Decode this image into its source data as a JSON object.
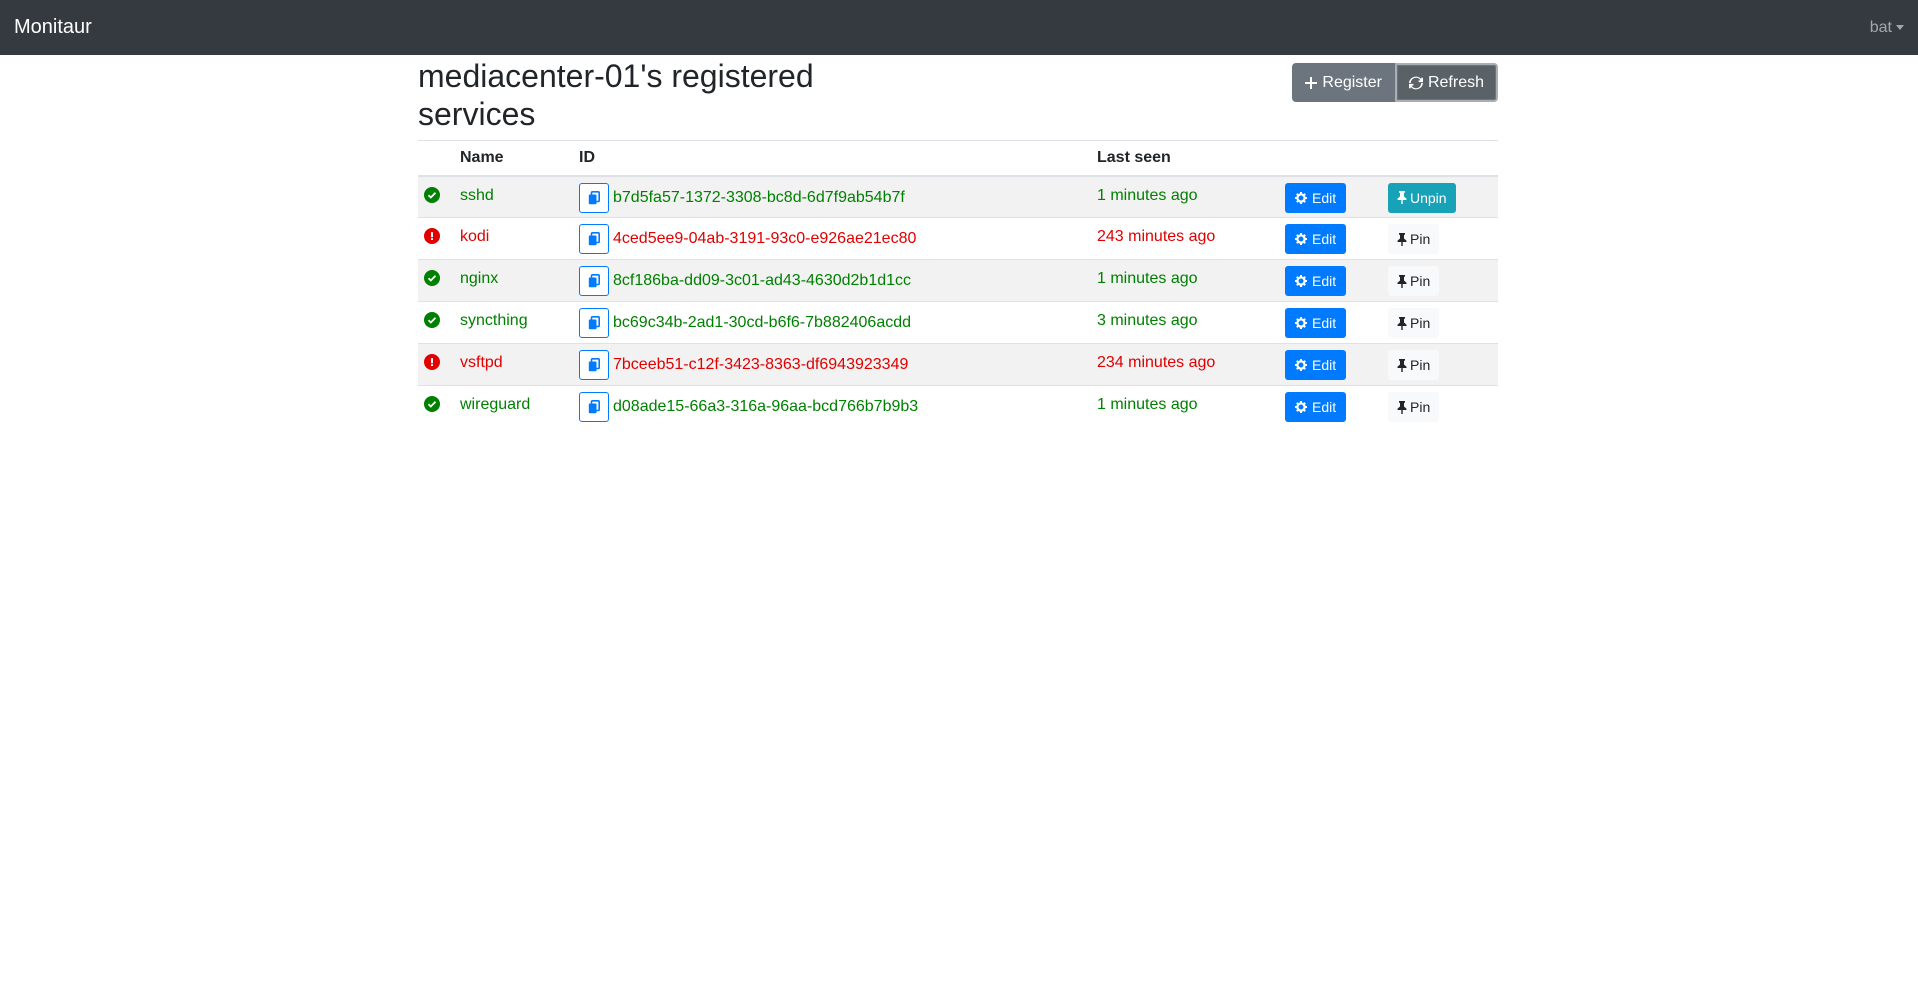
{
  "navbar": {
    "brand": "Monitaur",
    "user": "bat"
  },
  "page": {
    "title": "mediacenter-01's registered services",
    "register_label": "Register",
    "refresh_label": "Refresh"
  },
  "table": {
    "headers": [
      "",
      "Name",
      "ID",
      "Last seen",
      "",
      ""
    ],
    "rows": [
      {
        "status": "ok",
        "name": "sshd",
        "id": "b7d5fa57-1372-3308-bc8d-6d7f9ab54b7f",
        "last_seen": "1 minutes ago",
        "edit": "Edit",
        "pin": "Unpin",
        "pinned": true
      },
      {
        "status": "bad",
        "name": "kodi",
        "id": "4ced5ee9-04ab-3191-93c0-e926ae21ec80",
        "last_seen": "243 minutes ago",
        "edit": "Edit",
        "pin": "Pin",
        "pinned": false
      },
      {
        "status": "ok",
        "name": "nginx",
        "id": "8cf186ba-dd09-3c01-ad43-4630d2b1d1cc",
        "last_seen": "1 minutes ago",
        "edit": "Edit",
        "pin": "Pin",
        "pinned": false
      },
      {
        "status": "ok",
        "name": "syncthing",
        "id": "bc69c34b-2ad1-30cd-b6f6-7b882406acdd",
        "last_seen": "3 minutes ago",
        "edit": "Edit",
        "pin": "Pin",
        "pinned": false
      },
      {
        "status": "bad",
        "name": "vsftpd",
        "id": "7bceeb51-c12f-3423-8363-df6943923349",
        "last_seen": "234 minutes ago",
        "edit": "Edit",
        "pin": "Pin",
        "pinned": false
      },
      {
        "status": "ok",
        "name": "wireguard",
        "id": "d08ade15-66a3-316a-96aa-bcd766b7b9b3",
        "last_seen": "1 minutes ago",
        "edit": "Edit",
        "pin": "Pin",
        "pinned": false
      }
    ]
  },
  "icons": {
    "status_ok": "check-circle-icon",
    "status_bad": "exclamation-circle-icon",
    "copy": "copy-icon",
    "edit": "gear-icon",
    "pin": "thumbtack-icon",
    "register": "plus-icon",
    "refresh": "sync-icon"
  },
  "colors": {
    "ok": "#008000",
    "bad": "#e00000",
    "primary": "#007bff",
    "info": "#17a2b8",
    "navbar": "#343a40"
  }
}
